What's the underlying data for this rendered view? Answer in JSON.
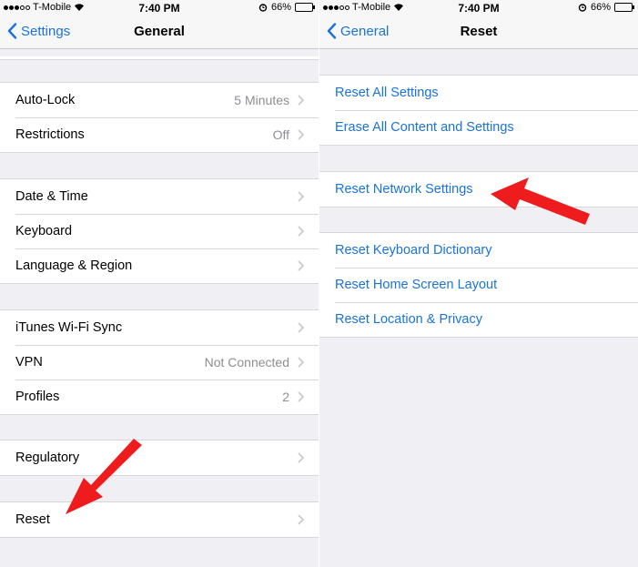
{
  "status": {
    "carrier": "T-Mobile",
    "time": "7:40 PM",
    "battery": "66%",
    "battery_level": 0.66
  },
  "left": {
    "nav": {
      "back_label": "Settings",
      "title": "General"
    },
    "groups": [
      [
        {
          "label": "Auto-Lock",
          "value": "5 Minutes"
        },
        {
          "label": "Restrictions",
          "value": "Off"
        }
      ],
      [
        {
          "label": "Date & Time",
          "value": ""
        },
        {
          "label": "Keyboard",
          "value": ""
        },
        {
          "label": "Language & Region",
          "value": ""
        }
      ],
      [
        {
          "label": "iTunes Wi-Fi Sync",
          "value": ""
        },
        {
          "label": "VPN",
          "value": "Not Connected"
        },
        {
          "label": "Profiles",
          "value": "2"
        }
      ],
      [
        {
          "label": "Regulatory",
          "value": ""
        }
      ],
      [
        {
          "label": "Reset",
          "value": ""
        }
      ]
    ]
  },
  "right": {
    "nav": {
      "back_label": "General",
      "title": "Reset"
    },
    "groups": [
      [
        {
          "label": "Reset All Settings"
        },
        {
          "label": "Erase All Content and Settings"
        }
      ],
      [
        {
          "label": "Reset Network Settings"
        }
      ],
      [
        {
          "label": "Reset Keyboard Dictionary"
        },
        {
          "label": "Reset Home Screen Layout"
        },
        {
          "label": "Reset Location & Privacy"
        }
      ]
    ]
  },
  "colors": {
    "link_blue": "#1a73d9",
    "annotation_red": "#ee1c1c",
    "grouped_background": "#efeff4"
  }
}
